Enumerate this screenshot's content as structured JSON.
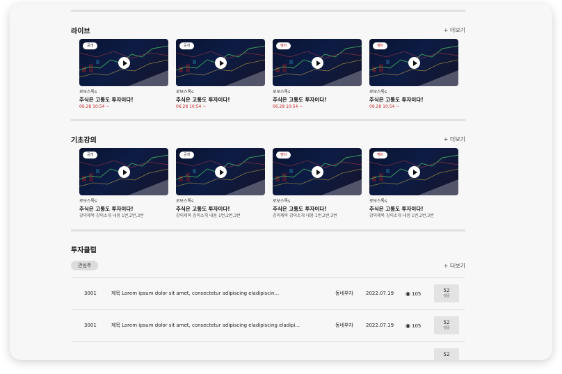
{
  "live": {
    "title": "라이브",
    "more": "+ 더보기",
    "cards": [
      {
        "badge": "공개",
        "badge_red": false,
        "author": "로보스톡s",
        "title": "주식은 고통도 투자이다!",
        "sub": "06.28 10:54 ~"
      },
      {
        "badge": "공개",
        "badge_red": false,
        "author": "로보스톡s",
        "title": "주식은 고통도 투자이다!",
        "sub": "06.28 10:54 ~"
      },
      {
        "badge": "멤버",
        "badge_red": true,
        "author": "로보스톡s",
        "title": "주식은 고통도 투자이다!",
        "sub": "06.28 10:54 ~"
      },
      {
        "badge": "멤버",
        "badge_red": true,
        "author": "로보스톡s",
        "title": "주식은 고통도 투자이다!",
        "sub": "06.28 10:54 ~"
      }
    ]
  },
  "basic": {
    "title": "기초강의",
    "more": "+ 더보기",
    "cards": [
      {
        "badge": "공개",
        "badge_red": false,
        "author": "로보스톡s",
        "title": "주식은 고통도 투자이다!",
        "sub": "강의제목 강의소개 내용 1번,2번,3번"
      },
      {
        "badge": "공개",
        "badge_red": false,
        "author": "로보스톡s",
        "title": "주식은 고통도 투자이다!",
        "sub": "강의제목 강의소개 내용 1번,2번,3번"
      },
      {
        "badge": "멤버",
        "badge_red": true,
        "author": "로보스톡s",
        "title": "주식은 고통도 투자이다!",
        "sub": "강의제목 강의소개 내용 1번,2번,3번"
      },
      {
        "badge": "멤버",
        "badge_red": true,
        "author": "로보스톡s",
        "title": "주식은 고통도 투자이다!",
        "sub": "강의제목 강의소개 내용 1번,2번,3번"
      }
    ]
  },
  "club": {
    "title": "투자클럽",
    "chip": "관심주",
    "more": "+ 더보기",
    "posts": [
      {
        "num": "3001",
        "title": "제목 Lorem ipsum dolor sit amet, consectetur adipiscing eladipiscin...",
        "author": "동네부자",
        "date": "2022.07.19",
        "views": "105",
        "comments": "52",
        "comment_label": "댓글"
      },
      {
        "num": "3001",
        "title": "제목 Lorem ipsum dolor sit amet, consectetur adipiscing eladipiscing eladipi...",
        "author": "동네부자",
        "date": "2022.07.19",
        "views": "105",
        "comments": "52",
        "comment_label": "댓글"
      },
      {
        "num": "",
        "title": "",
        "author": "",
        "date": "",
        "views": "",
        "comments": "52",
        "comment_label": ""
      }
    ]
  },
  "icons": {
    "play": "play-icon",
    "eye": "eye-icon"
  },
  "colors": {
    "accent_red": "#c62828",
    "background": "#f7f7f7",
    "divider": "#e1e1e1",
    "chip_bg": "#dcdcdc"
  }
}
